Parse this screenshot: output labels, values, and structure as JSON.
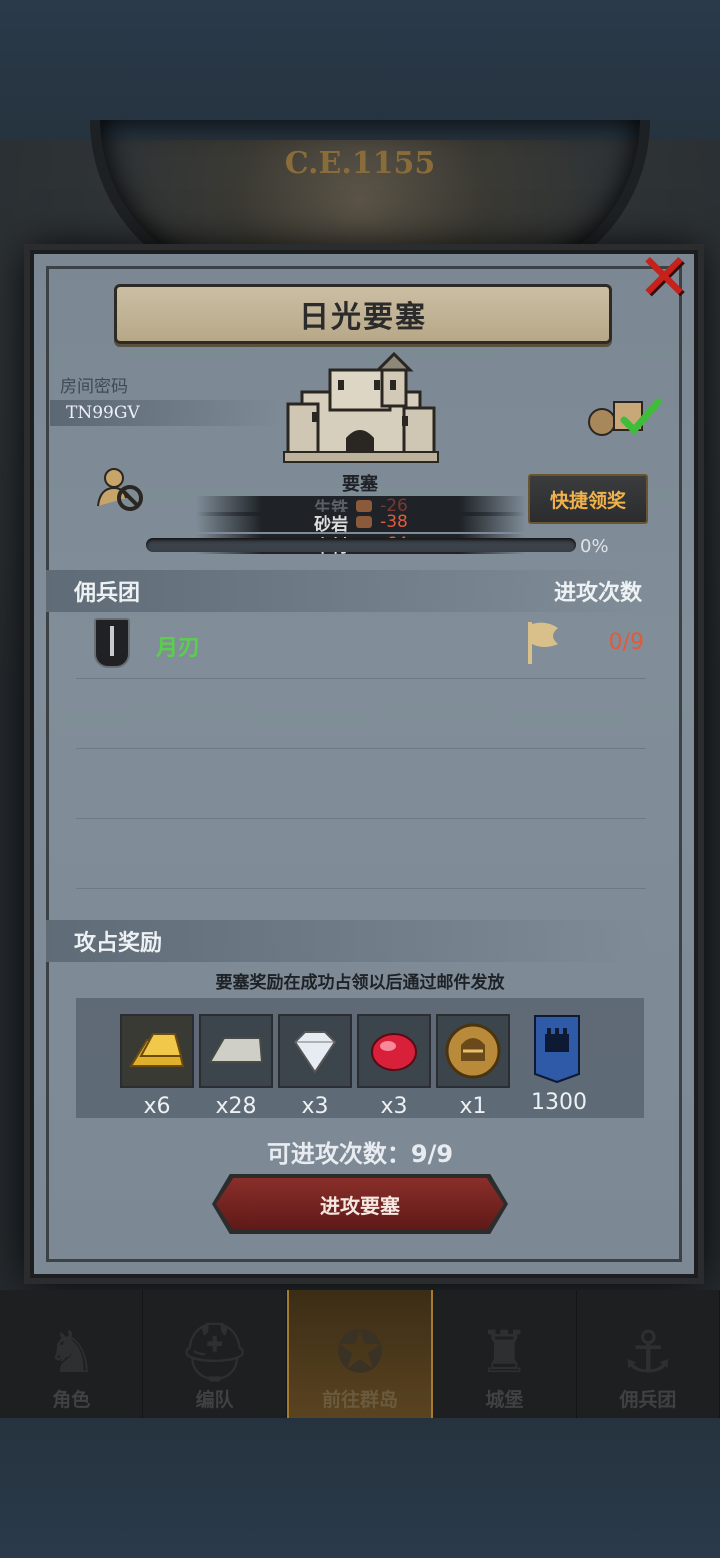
{
  "era": "C.E.1155",
  "dialog": {
    "title": "日光要塞",
    "room_code_label": "房间密码",
    "room_code": "TN99GV",
    "building_label": "要塞",
    "quick_claim_label": "快捷领奖",
    "resources": [
      {
        "name": "生铁",
        "value": "-26",
        "faded": true
      },
      {
        "name": "砂岩",
        "value": "-38",
        "faded": false
      },
      {
        "name": "木材",
        "value": "-64",
        "faded": false
      }
    ],
    "progress_text": "0%",
    "progress_value": 0
  },
  "mercenary_section": {
    "title": "佣兵团",
    "right_label": "进攻次数",
    "rows": [
      {
        "name": "月刃",
        "count": "0/9"
      }
    ]
  },
  "reward_section": {
    "title": "攻占奖励",
    "note": "要塞奖励在成功占领以后通过邮件发放",
    "items": [
      {
        "icon": "gold-bars-icon",
        "count": "x6"
      },
      {
        "icon": "silver-bar-icon",
        "count": "x28"
      },
      {
        "icon": "diamond-icon",
        "count": "x3"
      },
      {
        "icon": "ruby-icon",
        "count": "x3"
      },
      {
        "icon": "knight-medal-icon",
        "count": "x1"
      },
      {
        "icon": "castle-banner-icon",
        "count": "1300"
      }
    ]
  },
  "attempts_text": "可进攻次数：9/9",
  "attack_button_label": "进攻要塞",
  "nav": [
    {
      "label": "角色",
      "icon": "knight-icon",
      "active": false
    },
    {
      "label": "编队",
      "icon": "helmet-icon",
      "active": false
    },
    {
      "label": "前往群岛",
      "icon": "compass-icon",
      "active": true
    },
    {
      "label": "城堡",
      "icon": "castle-icon",
      "active": false
    },
    {
      "label": "佣兵团",
      "icon": "ship-icon",
      "active": false
    }
  ],
  "colors": {
    "accent_gold": "#f0b04a",
    "merc_green": "#5ad04a",
    "count_red": "#e25a3a",
    "attack_button": "#8a2e2a",
    "close_red": "#c8201a"
  }
}
